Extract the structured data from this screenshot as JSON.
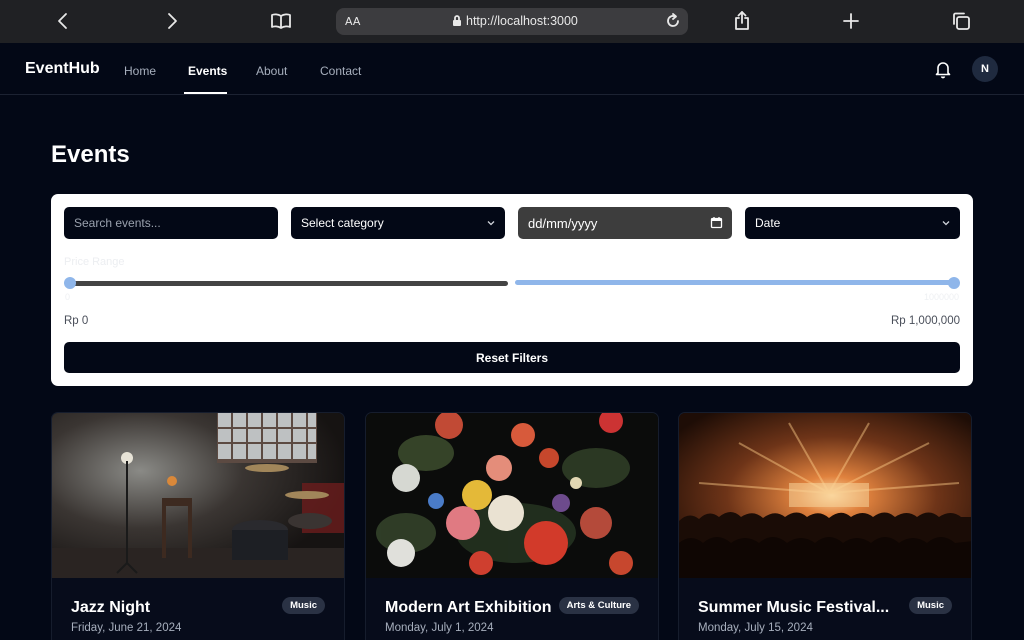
{
  "browser": {
    "text_size_label": "AA",
    "url": "http://localhost:3000"
  },
  "nav": {
    "brand": "EventHub",
    "links": [
      "Home",
      "Events",
      "About",
      "Contact"
    ],
    "active_link": "Events",
    "avatar_initial": "N"
  },
  "page": {
    "title": "Events"
  },
  "filters": {
    "search_placeholder": "Search events...",
    "category_value": "Select category",
    "date_placeholder": "dd/mm/yyyy",
    "sort_value": "Date",
    "price_label": "Price Range",
    "price_min": "Rp 0",
    "price_max": "Rp 1,000,000",
    "price_faint_min": "0",
    "price_faint_max": "1000000",
    "reset_label": "Reset Filters"
  },
  "events": [
    {
      "title": "Jazz Night",
      "category": "Music",
      "date": "Friday, June 21, 2024",
      "image": "jazz-stage"
    },
    {
      "title": "Modern Art Exhibition",
      "category": "Arts & Culture",
      "date": "Monday, July 1, 2024",
      "image": "flower-painting"
    },
    {
      "title": "Summer Music Festival...",
      "category": "Music",
      "date": "Monday, July 15, 2024",
      "image": "concert-crowd"
    }
  ],
  "colors": {
    "background": "#030816",
    "panel": "#ffffff",
    "accent": "#8fb6ea",
    "badge": "#2a3244"
  }
}
